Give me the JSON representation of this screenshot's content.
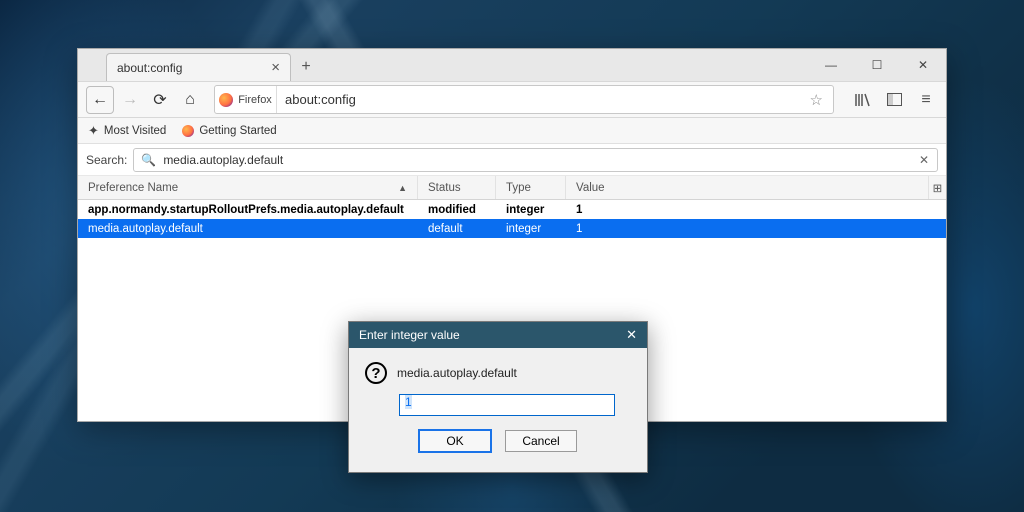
{
  "tab": {
    "title": "about:config"
  },
  "navbar": {
    "identity_label": "Firefox",
    "url": "about:config"
  },
  "bookmarks": {
    "item1": "Most Visited",
    "item2": "Getting Started"
  },
  "search": {
    "label": "Search:",
    "value": "media.autoplay.default"
  },
  "columns": {
    "pref": "Preference Name",
    "status": "Status",
    "type": "Type",
    "value": "Value"
  },
  "rows": [
    {
      "pref": "app.normandy.startupRolloutPrefs.media.autoplay.default",
      "status": "modified",
      "type": "integer",
      "value": "1"
    },
    {
      "pref": "media.autoplay.default",
      "status": "default",
      "type": "integer",
      "value": "1"
    }
  ],
  "dialog": {
    "title": "Enter integer value",
    "pref": "media.autoplay.default",
    "input_value": "1",
    "ok": "OK",
    "cancel": "Cancel"
  }
}
